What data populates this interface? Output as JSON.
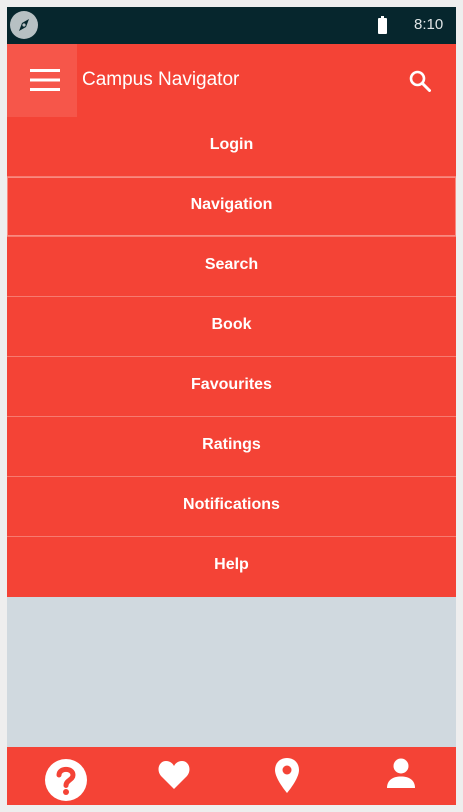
{
  "status_bar": {
    "time": "8:10",
    "left_icon": "compass-icon",
    "battery_icon": "battery-icon"
  },
  "app_bar": {
    "menu_icon": "hamburger-menu-icon",
    "title": "Campus Navigator",
    "search_icon": "search-icon"
  },
  "menu": {
    "items": [
      {
        "label": "Login"
      },
      {
        "label": "Navigation"
      },
      {
        "label": "Search"
      },
      {
        "label": "Book"
      },
      {
        "label": "Favourites"
      },
      {
        "label": "Ratings"
      },
      {
        "label": "Notifications"
      },
      {
        "label": "Help"
      }
    ]
  },
  "bottom_nav": {
    "items": [
      {
        "icon": "help-icon"
      },
      {
        "icon": "heart-icon"
      },
      {
        "icon": "location-pin-icon"
      },
      {
        "icon": "person-icon"
      }
    ]
  },
  "colors": {
    "primary": "#f44336",
    "status_bar": "#06262d",
    "content_background": "#d0d9df",
    "menu_button_highlight": "#f6564a",
    "text": "#ffffff"
  }
}
